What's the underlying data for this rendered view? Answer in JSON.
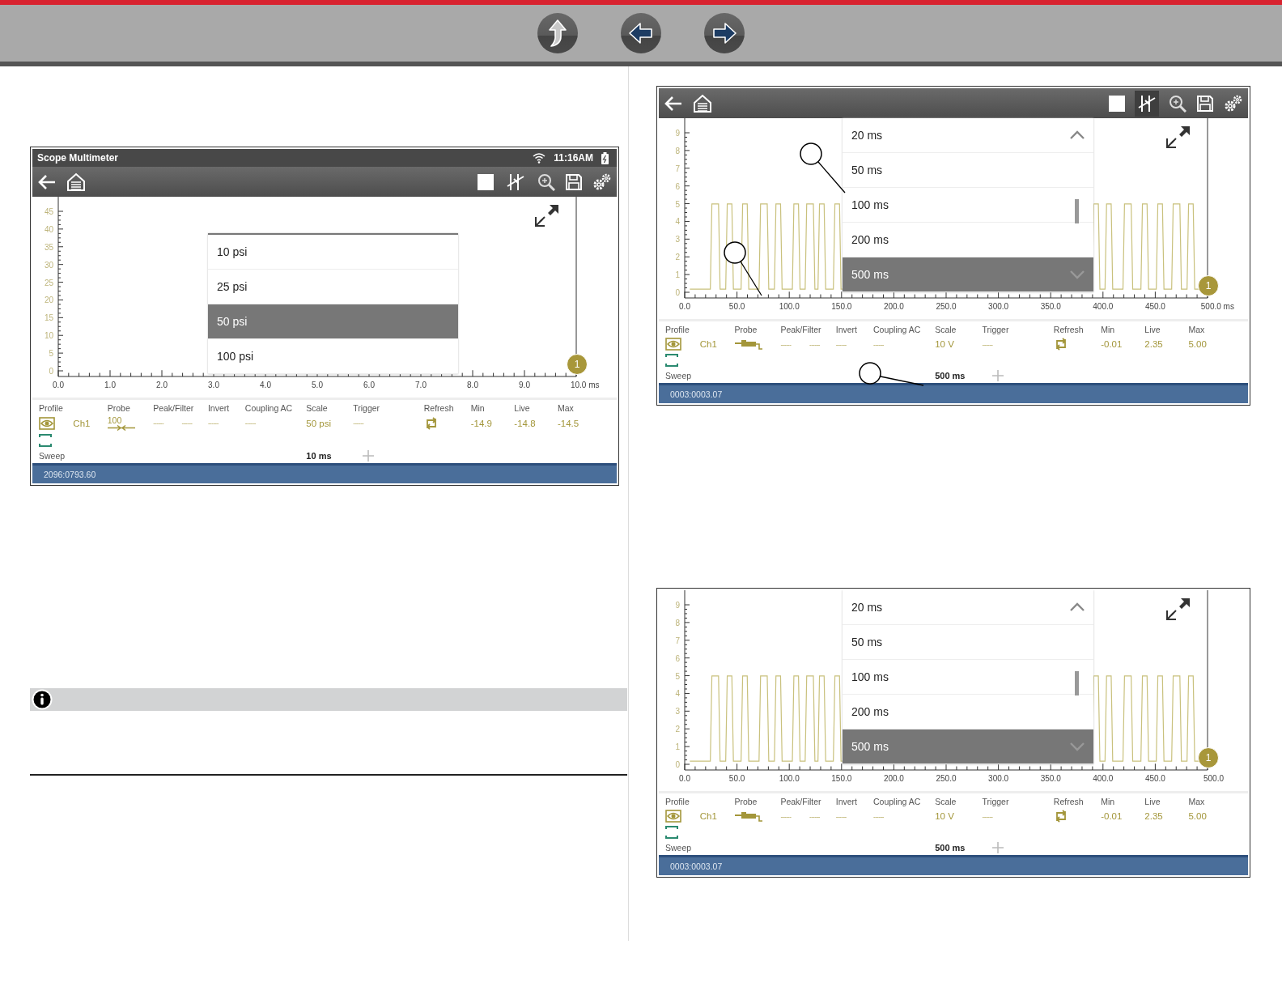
{
  "screens": [
    {
      "status_bar": {
        "title": "Scope Multimeter",
        "time": "11:16AM"
      },
      "toolbar": {
        "cursors_active": false
      },
      "y_labels": [
        "45",
        "40",
        "35",
        "30",
        "25",
        "20",
        "15",
        "10",
        "5",
        "0"
      ],
      "x_labels": [
        "0.0",
        "1.0",
        "2.0",
        "3.0",
        "4.0",
        "5.0",
        "6.0",
        "7.0",
        "8.0",
        "9.0",
        "10.0 ms"
      ],
      "dropdown": {
        "kind": "list",
        "items": [
          {
            "label": "10 psi",
            "selected": false
          },
          {
            "label": "25 psi",
            "selected": false
          },
          {
            "label": "50 psi",
            "selected": true
          },
          {
            "label": "100 psi",
            "selected": false
          }
        ]
      },
      "channel_badge": "1",
      "control_headers": [
        "Profile",
        "Probe",
        "Peak/Filter",
        "Invert",
        "Coupling AC",
        "Scale",
        "Trigger",
        "Refresh",
        "Min",
        "Live",
        "Max"
      ],
      "channel": {
        "name": "Ch1",
        "probe_label": "100",
        "peak": "------",
        "filter": "------",
        "invert": "------",
        "coupling": "------",
        "scale": "50 psi",
        "trigger": "------",
        "min": "-14.9",
        "live": "-14.8",
        "max": "-14.5"
      },
      "sweep": {
        "label": "Sweep",
        "value": "10 ms"
      },
      "footer": "2096:0793.60"
    },
    {
      "toolbar": {
        "cursors_active": true
      },
      "y_labels": [
        "9",
        "8",
        "7",
        "6",
        "5",
        "4",
        "3",
        "2",
        "1",
        "0"
      ],
      "x_labels": [
        "0.0",
        "50.0",
        "100.0",
        "150.0",
        "200.0",
        "250.0",
        "300.0",
        "350.0",
        "400.0",
        "450.0",
        "500.0 ms"
      ],
      "waveform": {
        "kind": "picture"
      },
      "dropdown": {
        "kind": "scroller",
        "items": [
          {
            "label": "20 ms",
            "selected": false
          },
          {
            "label": "50 ms",
            "selected": false
          },
          {
            "label": "100 ms",
            "selected": false
          },
          {
            "label": "200 ms",
            "selected": false
          },
          {
            "label": "500 ms",
            "selected": true
          }
        ]
      },
      "channel_badge": "1",
      "callouts": [
        {
          "kind": "blank"
        },
        {
          "kind": "blank"
        },
        {
          "kind": "blank"
        }
      ],
      "control_headers": [
        "Profile",
        "Probe",
        "Peak/Filter",
        "Invert",
        "Coupling AC",
        "Scale",
        "Trigger",
        "Refresh",
        "Min",
        "Live",
        "Max"
      ],
      "channel": {
        "name": "Ch1",
        "peak": "------",
        "filter": "------",
        "invert": "------",
        "coupling": "------",
        "scale": "10 V",
        "trigger": "------",
        "min": "-0.01",
        "live": "2.35",
        "max": "5.00"
      },
      "sweep": {
        "label": "Sweep",
        "value": "500 ms"
      },
      "footer": "0003:0003.07"
    },
    {
      "y_labels": [
        "9",
        "8",
        "7",
        "6",
        "5",
        "4",
        "3",
        "2",
        "1",
        "0"
      ],
      "x_labels": [
        "0.0",
        "50.0",
        "100.0",
        "150.0",
        "200.0",
        "250.0",
        "300.0",
        "350.0",
        "400.0",
        "450.0",
        "500.0"
      ],
      "waveform": {
        "kind": "picture"
      },
      "dropdown": {
        "kind": "scroller",
        "items": [
          {
            "label": "20 ms",
            "selected": false
          },
          {
            "label": "50 ms",
            "selected": false
          },
          {
            "label": "100 ms",
            "selected": false
          },
          {
            "label": "200 ms",
            "selected": false
          },
          {
            "label": "500 ms",
            "selected": true
          }
        ]
      },
      "channel_badge": "1",
      "control_headers": [
        "Profile",
        "Probe",
        "Peak/Filter",
        "Invert",
        "Coupling AC",
        "Scale",
        "Trigger",
        "Refresh",
        "Min",
        "Live",
        "Max"
      ],
      "channel": {
        "name": "Ch1",
        "peak": "------",
        "filter": "------",
        "invert": "------",
        "coupling": "------",
        "scale": "10 V",
        "trigger": "------",
        "min": "-0.01",
        "live": "2.35",
        "max": "5.00"
      },
      "sweep": {
        "label": "Sweep",
        "value": "500 ms"
      },
      "footer": "0003:0003.07"
    }
  ]
}
